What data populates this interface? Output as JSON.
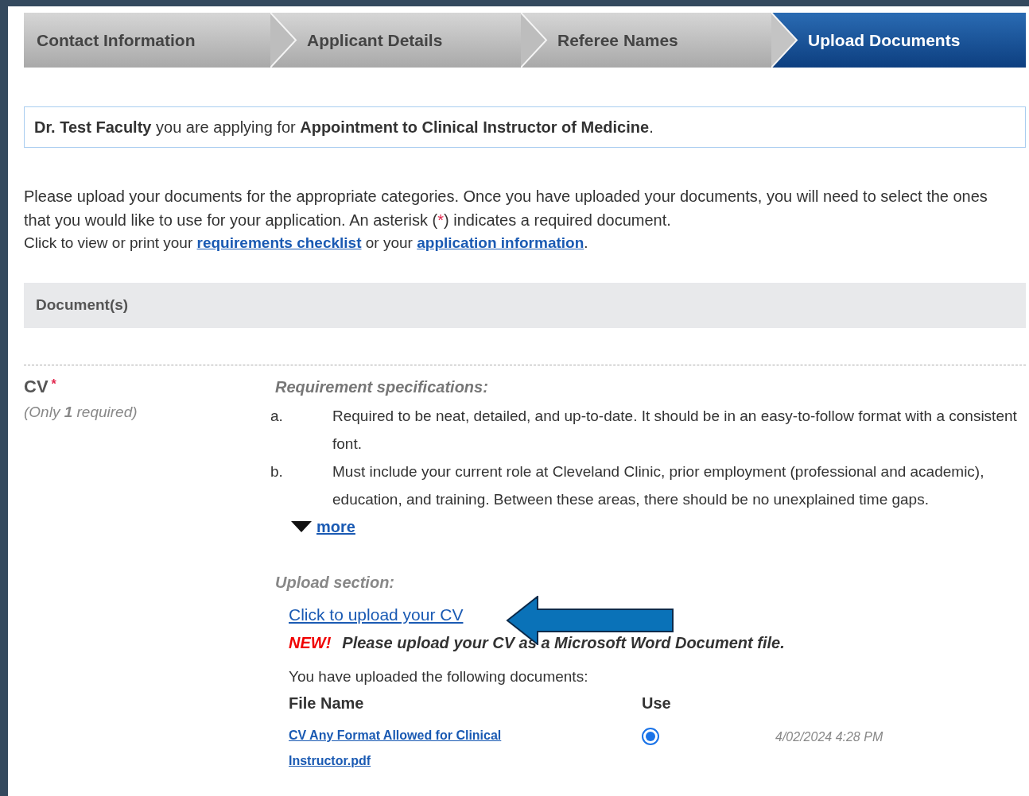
{
  "steps": [
    {
      "label": "Contact Information",
      "selected": false
    },
    {
      "label": "Applicant Details",
      "selected": false
    },
    {
      "label": "Referee Names",
      "selected": false
    },
    {
      "label": "Upload Documents",
      "selected": true
    }
  ],
  "applying_notice": "**Dr. Test Faculty** you are applying for **Appointment to Clinical Instructor of Medicine**.",
  "instructions": {
    "before": "Please upload your documents for the appropriate categories. Once you have uploaded your documents, you will need to select the ones that you would like to use for your application. An asterisk (",
    "mark": "*",
    "after": ") indicates a required document."
  },
  "links_line": {
    "prefix": "Click to view or print your ",
    "link_1": "requirements checklist",
    "middle": " or your ",
    "link_2": "application information",
    "suffix": "."
  },
  "section_header": "Document(s)",
  "document": {
    "name": "CV",
    "required_mark": "*",
    "count_note": "(Only **1** required)",
    "spec_heading": "Requirement specifications:",
    "specs": [
      {
        "marker": "a.",
        "text": "Required to be neat, detailed, and up-to-date. It should be in an easy-to-follow format with a consistent font."
      },
      {
        "marker": "b.",
        "text": "Must include your current role at Cleveland Clinic, prior employment (professional and academic), education, and training. Between these areas, there should be no unexplained time gaps."
      }
    ],
    "more_link": "more",
    "upload_heading": "Upload section:",
    "upload_link": "Click to upload your CV",
    "new_badge": "NEW!",
    "new_note": "Please upload your CV as a Microsoft Word Document file.",
    "uploaded_intro": "You have uploaded the following documents:",
    "columns": [
      "File Name",
      "Use"
    ],
    "files": [
      {
        "name": "CV Any Format Allowed for Clinical Instructor.pdf",
        "selected": true,
        "date": "4/02/2024 4:28 PM"
      }
    ]
  }
}
